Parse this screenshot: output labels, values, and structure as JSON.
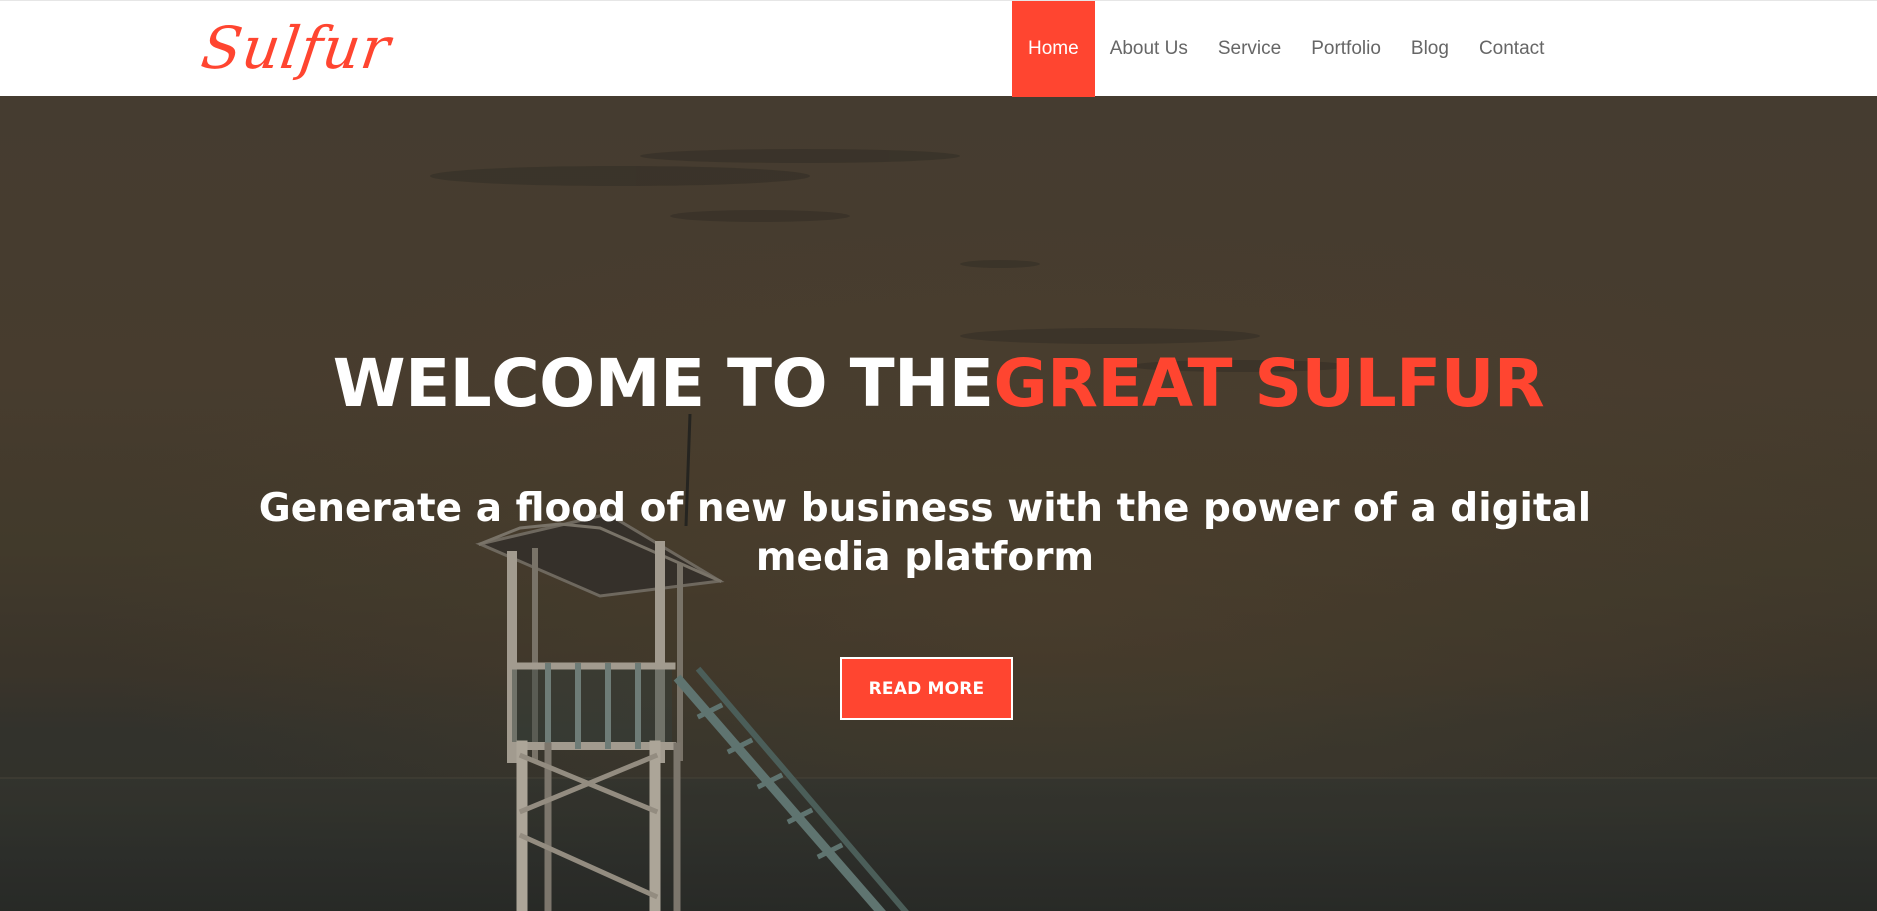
{
  "brand": {
    "logo_text": "Sulfur",
    "accent_color": "#ff4530"
  },
  "nav": {
    "items": [
      {
        "label": "Home",
        "active": true
      },
      {
        "label": "About Us",
        "active": false
      },
      {
        "label": "Service",
        "active": false
      },
      {
        "label": "Portfolio",
        "active": false
      },
      {
        "label": "Blog",
        "active": false
      },
      {
        "label": "Contact",
        "active": false
      }
    ]
  },
  "hero": {
    "title_prefix": "WELCOME TO THE",
    "title_highlight": "GREAT SULFUR",
    "subtitle": "Generate a flood of new business with the power of a digital media platform",
    "cta_label": "READ MORE",
    "background_image": "beach-lifeguard-tower-at-sunset"
  }
}
